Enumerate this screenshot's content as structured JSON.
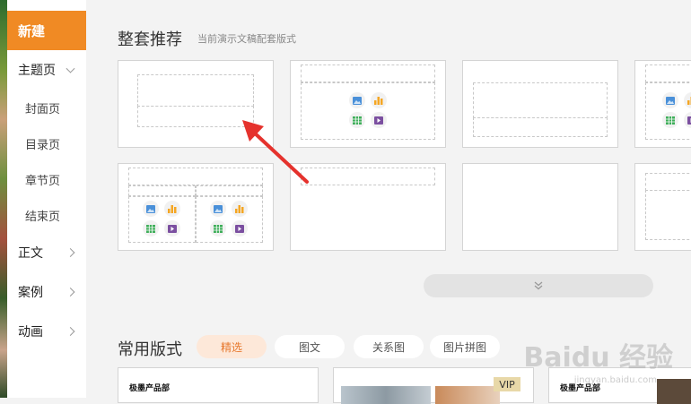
{
  "sidebar": {
    "new_label": "新建",
    "items": [
      {
        "label": "主题页",
        "chevron": "down"
      },
      {
        "label": "封面页"
      },
      {
        "label": "目录页"
      },
      {
        "label": "章节页"
      },
      {
        "label": "结束页"
      },
      {
        "label": "正文",
        "chevron": "right"
      },
      {
        "label": "案例",
        "chevron": "right"
      },
      {
        "label": "动画",
        "chevron": "right"
      }
    ]
  },
  "section1": {
    "title": "整套推荐",
    "subtitle": "当前演示文稿配套版式"
  },
  "section2": {
    "title": "常用版式",
    "tabs": [
      "精选",
      "图文",
      "关系图",
      "图片拼图"
    ]
  },
  "bottom_cards": {
    "card1_title": "极墨产品部",
    "card2_badge": "VIP",
    "card3_title": "极墨产品部"
  },
  "watermark": {
    "text": "Baidu 经验",
    "sub": "jingyan.baidu.com"
  },
  "colors": {
    "accent": "#f08a24",
    "arrow": "#e5322d"
  }
}
